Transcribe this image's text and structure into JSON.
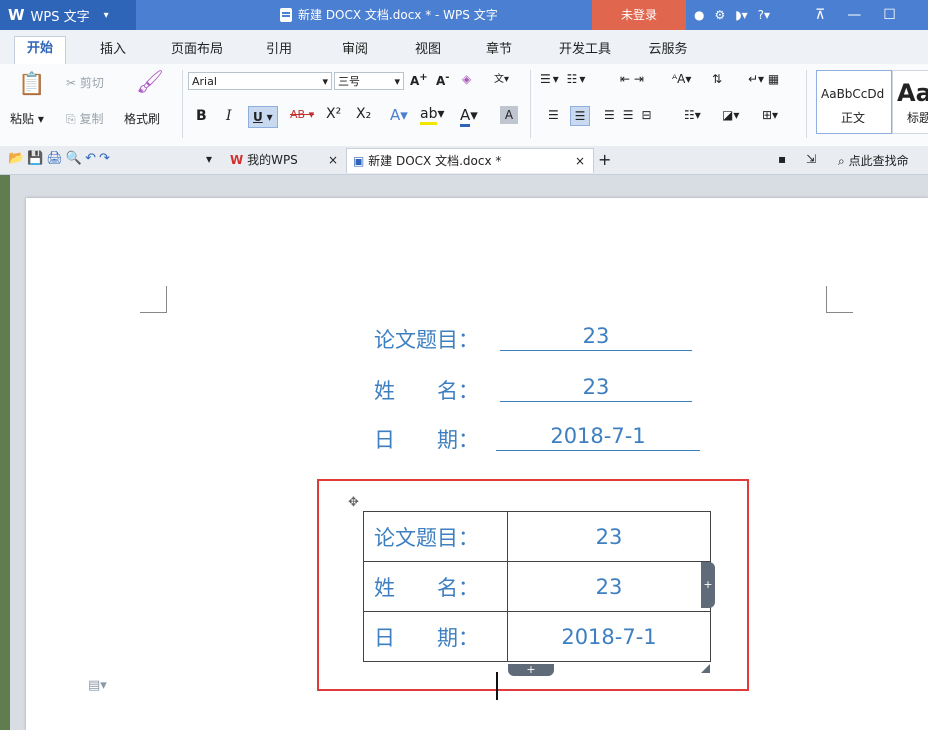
{
  "app": {
    "logo": "W",
    "name": "WPS 文字",
    "window_title": "新建 DOCX 文档.docx * - WPS 文字",
    "login": "未登录"
  },
  "menu": {
    "tabs": [
      "开始",
      "插入",
      "页面布局",
      "引用",
      "审阅",
      "视图",
      "章节",
      "开发工具",
      "云服务"
    ]
  },
  "ribbon": {
    "paste": "粘贴",
    "cut": "剪切",
    "copy": "复制",
    "format_painter": "格式刷",
    "font_name": "Arial",
    "font_size": "三号",
    "bold": "B",
    "italic": "I",
    "underline": "U",
    "strike": "AB",
    "superscript": "X²",
    "subscript": "X₂",
    "style_normal_preview": "AaBbCcDd",
    "style_normal": "正文",
    "style_heading_preview": "Aa",
    "style_heading": "标题"
  },
  "tabbar": {
    "my_wps": "我的WPS",
    "doc_tab": "新建 DOCX 文档.docx *",
    "search": "点此查找命"
  },
  "document": {
    "lines": [
      {
        "label": "论文题目：",
        "value": "23"
      },
      {
        "label": "姓　　名：",
        "value": "23"
      },
      {
        "label": "日　　期：",
        "value": "2018-7-1"
      }
    ],
    "table": [
      {
        "label": "论文题目：",
        "value": "23"
      },
      {
        "label": "姓　　名：",
        "value": "23"
      },
      {
        "label": "日　　期：",
        "value": "2018-7-1"
      }
    ]
  },
  "colors": {
    "title_bar": "#4a7fd1",
    "login_button": "#e0664d",
    "doc_text": "#3d7fc0",
    "highlight_box": "#e03a3a"
  }
}
